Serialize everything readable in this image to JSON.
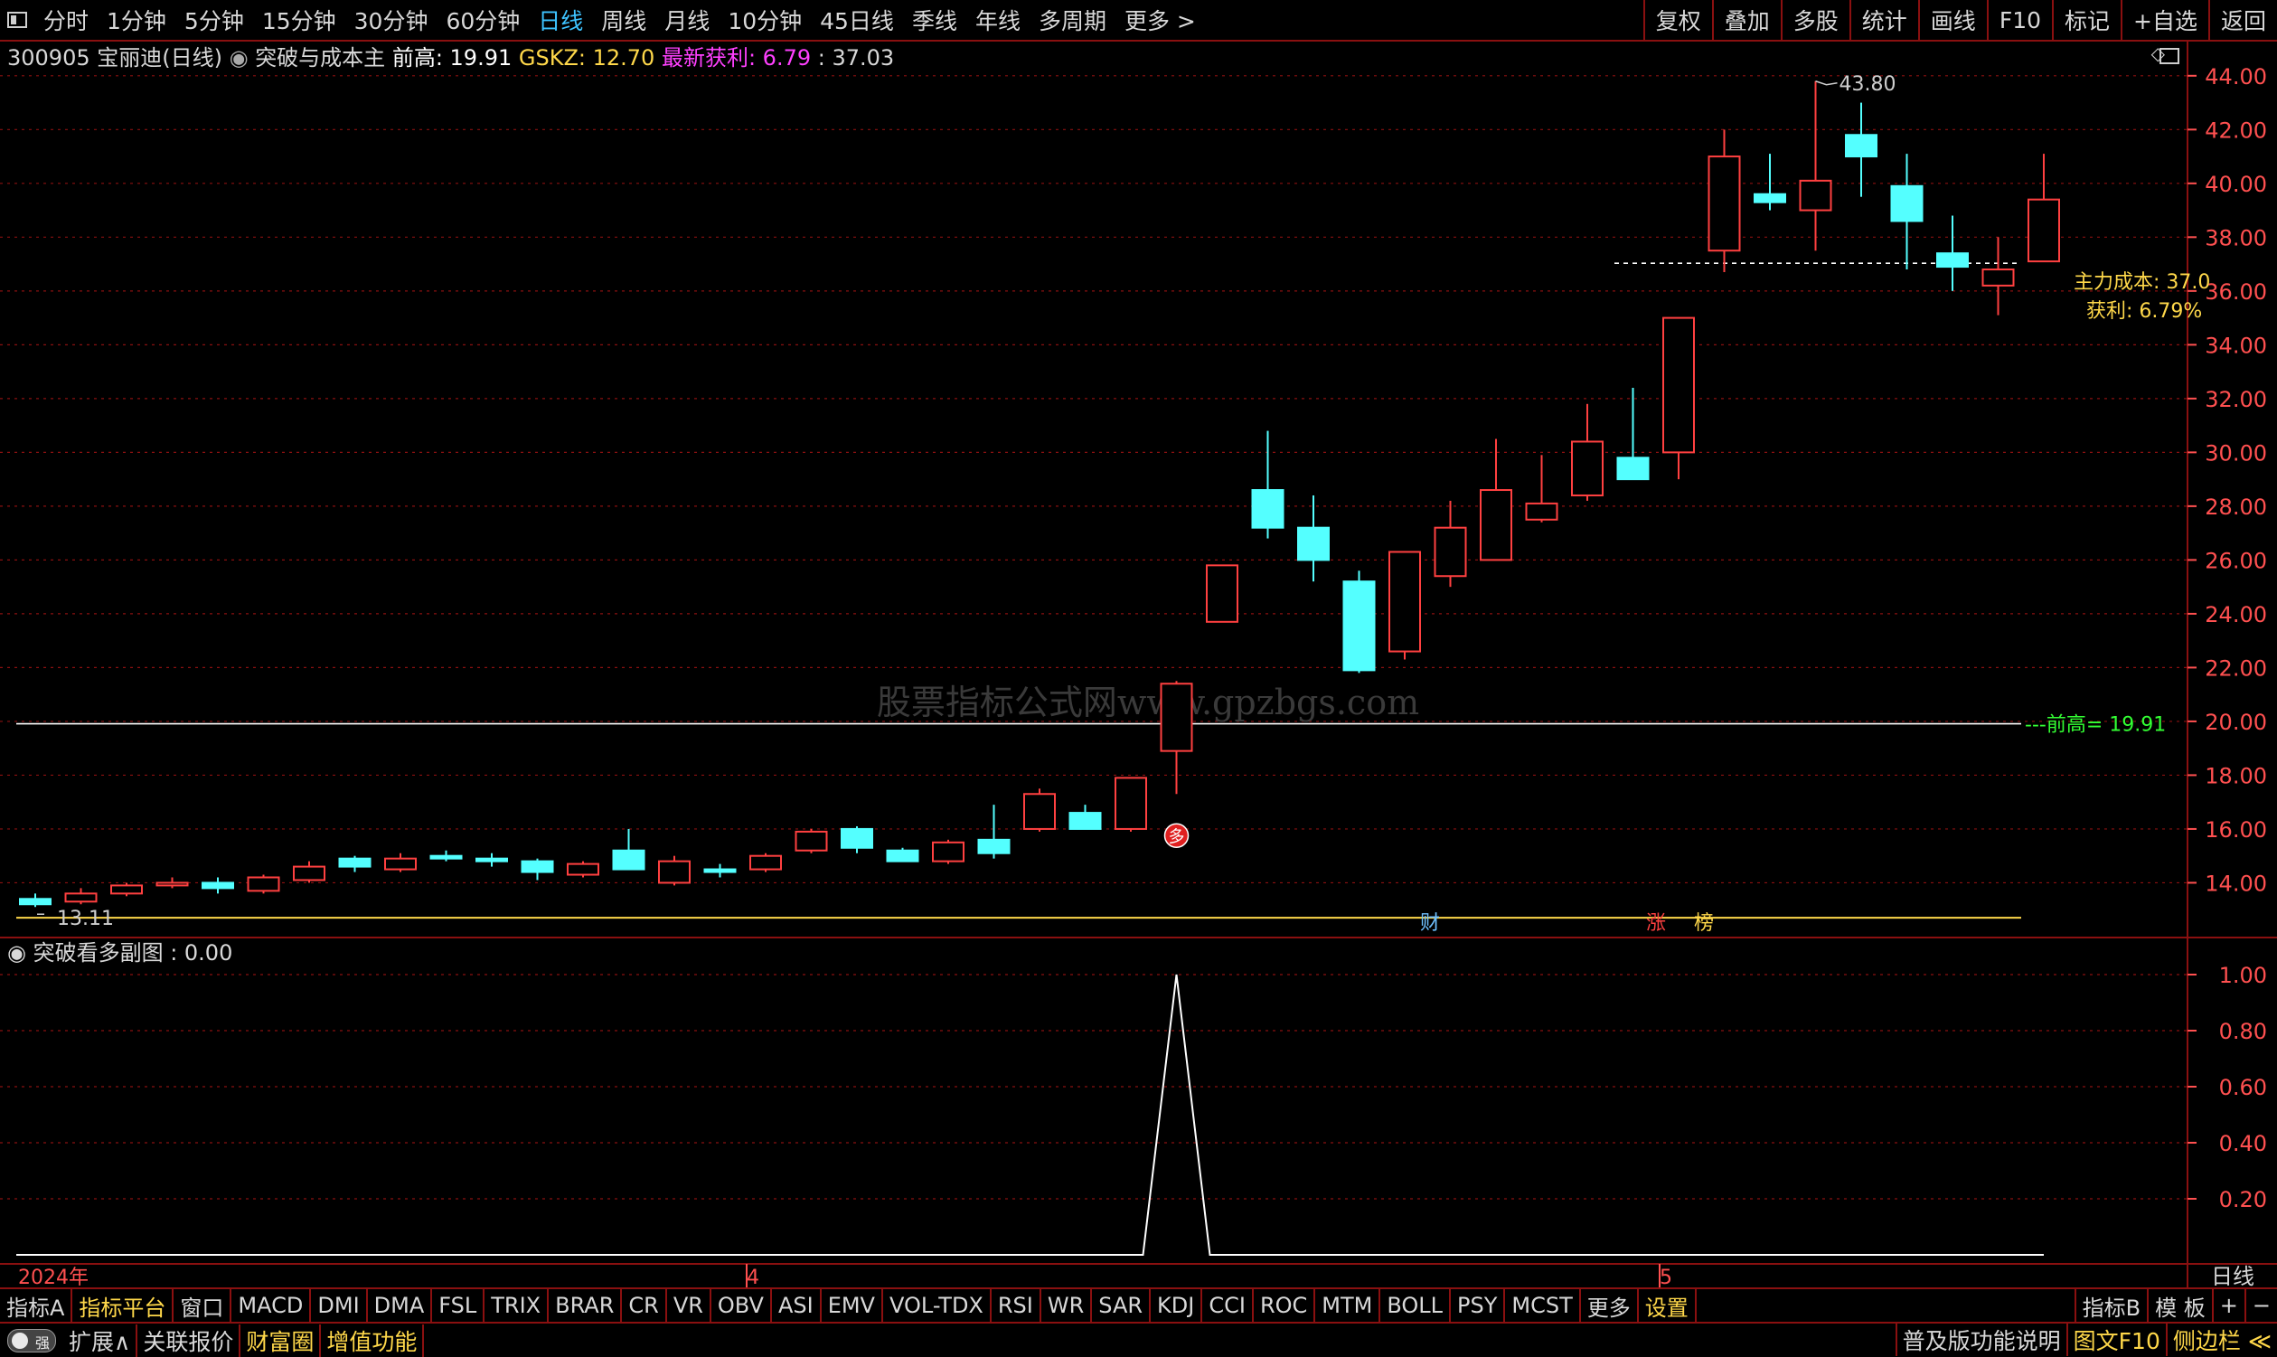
{
  "toolbar": {
    "left": [
      "分时",
      "1分钟",
      "5分钟",
      "15分钟",
      "30分钟",
      "60分钟",
      "日线",
      "周线",
      "月线",
      "10分钟",
      "45日线",
      "季线",
      "年线",
      "多周期",
      "更多 >"
    ],
    "active": "日线",
    "right": [
      "复权",
      "叠加",
      "多股",
      "统计",
      "画线",
      "F10",
      "标记",
      "+自选",
      "返回"
    ]
  },
  "header": {
    "stock": "300905 宝丽迪(日线)",
    "indicator": "突破与成本主",
    "qg_label": "前高:",
    "qg_value": "19.91",
    "gskz_label": "GSKZ:",
    "gskz_value": "12.70",
    "profit_label": "最新获利:",
    "profit_value": "6.79",
    "cost_sep": ":",
    "cost_value": "37.03"
  },
  "sub_header": {
    "title": "突破看多副图",
    "sep": ":",
    "value": "0.00"
  },
  "annotations": {
    "high": "43.80",
    "low": "13.11",
    "cost_label": "主力成本:",
    "cost_value": "37.0",
    "profit_label": "获利:",
    "profit_value": "6.79%",
    "qg_label": "前高=",
    "qg_value": "19.91",
    "signal": "多",
    "watermark": "股票指标公式网www.gpzbgs.com",
    "badges": [
      "财",
      "涨",
      "榜"
    ]
  },
  "colors": {
    "up": "#ff4040",
    "down": "#54ffff",
    "grid": "#8a1010",
    "cost": "#ffd84a",
    "qg": "#33ff33",
    "axis": "#ff5050"
  },
  "chart_data": [
    {
      "type": "candlestick",
      "y_axis_ticks": [
        "44.00",
        "42.00",
        "40.00",
        "38.00",
        "36.00",
        "34.00",
        "32.00",
        "30.00",
        "28.00",
        "26.00",
        "24.00",
        "22.00",
        "20.00",
        "18.00",
        "16.00",
        "14.00"
      ],
      "ylim": [
        12.2,
        44.8
      ],
      "x_labels": [
        "2024年",
        "4",
        "5"
      ],
      "ohlc": [
        [
          13.4,
          13.6,
          13.1,
          13.2
        ],
        [
          13.3,
          13.8,
          13.2,
          13.6
        ],
        [
          13.6,
          14.0,
          13.5,
          13.9
        ],
        [
          13.9,
          14.2,
          13.8,
          14.0
        ],
        [
          14.0,
          14.2,
          13.6,
          13.8
        ],
        [
          13.7,
          14.3,
          13.6,
          14.2
        ],
        [
          14.1,
          14.8,
          14.0,
          14.6
        ],
        [
          14.9,
          15.0,
          14.4,
          14.6
        ],
        [
          14.5,
          15.1,
          14.4,
          14.9
        ],
        [
          15.0,
          15.2,
          14.8,
          14.9
        ],
        [
          14.9,
          15.1,
          14.6,
          14.8
        ],
        [
          14.8,
          14.9,
          14.1,
          14.4
        ],
        [
          14.3,
          14.8,
          14.2,
          14.7
        ],
        [
          15.2,
          16.0,
          14.5,
          14.5
        ],
        [
          14.0,
          15.0,
          13.9,
          14.8
        ],
        [
          14.5,
          14.7,
          14.2,
          14.4
        ],
        [
          14.5,
          15.1,
          14.4,
          15.0
        ],
        [
          15.2,
          16.0,
          15.1,
          15.9
        ],
        [
          16.0,
          16.1,
          15.1,
          15.3
        ],
        [
          15.2,
          15.3,
          14.8,
          14.8
        ],
        [
          14.8,
          15.6,
          14.7,
          15.5
        ],
        [
          15.6,
          16.9,
          14.9,
          15.1
        ],
        [
          16.0,
          17.5,
          15.9,
          17.3
        ],
        [
          16.6,
          16.9,
          16.0,
          16.0
        ],
        [
          16.0,
          17.9,
          15.9,
          17.9
        ],
        [
          18.9,
          21.5,
          17.3,
          21.4
        ],
        [
          23.7,
          25.8,
          23.7,
          25.8
        ],
        [
          28.6,
          30.8,
          26.8,
          27.2
        ],
        [
          27.2,
          28.4,
          25.2,
          26.0
        ],
        [
          25.2,
          25.6,
          21.8,
          21.9
        ],
        [
          22.6,
          26.3,
          22.3,
          26.3
        ],
        [
          25.4,
          28.2,
          25.0,
          27.2
        ],
        [
          26.0,
          30.5,
          26.0,
          28.6
        ],
        [
          27.5,
          29.9,
          27.4,
          28.1
        ],
        [
          28.4,
          31.8,
          28.2,
          30.4
        ],
        [
          29.8,
          32.4,
          29.3,
          29.0
        ],
        [
          30.0,
          35.0,
          29.0,
          35.0
        ],
        [
          37.5,
          42.0,
          36.7,
          41.0
        ],
        [
          39.6,
          41.1,
          39.0,
          39.3
        ],
        [
          39.0,
          43.8,
          37.5,
          40.1
        ],
        [
          41.8,
          43.0,
          39.5,
          41.0
        ],
        [
          39.9,
          41.1,
          36.8,
          38.6
        ],
        [
          37.4,
          38.8,
          36.0,
          36.9
        ],
        [
          36.2,
          38.0,
          35.1,
          36.8
        ],
        [
          37.1,
          41.1,
          37.1,
          39.4
        ]
      ],
      "series": [
        {
          "name": "前高",
          "type": "hline",
          "value": 19.91
        },
        {
          "name": "GSKZ",
          "type": "hline",
          "value": 12.7
        },
        {
          "name": "主力成本",
          "type": "hline",
          "value": 37.03
        }
      ],
      "signal_index": 25
    },
    {
      "type": "line",
      "title": "突破看多副图",
      "y_axis_ticks": [
        "1.00",
        "0.80",
        "0.60",
        "0.40",
        "0.20"
      ],
      "ylim": [
        0,
        1.0
      ],
      "values": [
        0,
        0,
        0,
        0,
        0,
        0,
        0,
        0,
        0,
        0,
        0,
        0,
        0,
        0,
        0,
        0,
        0,
        0,
        0,
        0,
        0,
        0,
        0,
        0,
        0,
        1,
        0,
        0,
        0,
        0,
        0,
        0,
        0,
        0,
        0,
        0,
        0,
        0,
        0,
        0,
        0,
        0,
        0,
        0,
        0
      ],
      "right_label": "日线"
    }
  ],
  "bottom_tabs": [
    "指标A",
    "指标平台",
    "窗口",
    "MACD",
    "DMI",
    "DMA",
    "FSL",
    "TRIX",
    "BRAR",
    "CR",
    "VR",
    "OBV",
    "ASI",
    "EMV",
    "VOL-TDX",
    "RSI",
    "WR",
    "SAR",
    "KDJ",
    "CCI",
    "ROC",
    "MTM",
    "BOLL",
    "PSY",
    "MCST",
    "更多",
    "设置"
  ],
  "bottom_tabs_hl": [
    "指标平台",
    "设置"
  ],
  "bottom_right": [
    "指标B",
    "模 板",
    "+",
    "−"
  ],
  "status_bar": {
    "toggle": "强",
    "left": [
      "扩展∧",
      "关联报价",
      "财富圈",
      "增值功能"
    ],
    "left_hl": [
      "财富圈",
      "增值功能"
    ],
    "right": [
      "普及版功能说明",
      "图文F10",
      "侧边栏 ≪"
    ],
    "right_hl": [
      "图文F10",
      "侧边栏 ≪"
    ]
  }
}
